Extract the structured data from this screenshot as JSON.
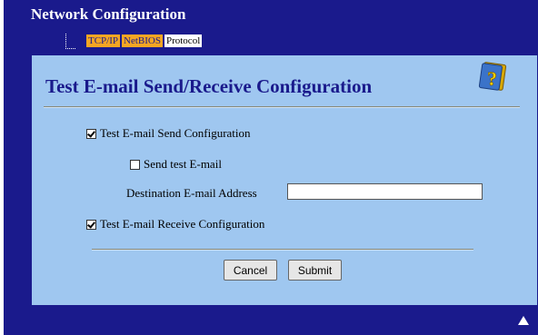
{
  "app": {
    "title": "Network Configuration"
  },
  "nav": {
    "tabs": [
      {
        "label": "TCP/IP"
      },
      {
        "label": "NetBIOS"
      },
      {
        "label": "Protocol"
      }
    ]
  },
  "panel": {
    "title": "Test E-mail Send/Receive Configuration",
    "help_icon": "help-book-icon"
  },
  "form": {
    "send_config": {
      "label": "Test E-mail Send Configuration",
      "checked": true
    },
    "send_test": {
      "label": "Send test E-mail",
      "checked": false
    },
    "destination": {
      "label": "Destination E-mail Address",
      "value": "",
      "placeholder": ""
    },
    "receive_config": {
      "label": "Test E-mail Receive Configuration",
      "checked": true
    }
  },
  "buttons": {
    "cancel": "Cancel",
    "submit": "Submit"
  },
  "colors": {
    "background": "#1a1a8c",
    "panel": "#9fc7f0",
    "tab_highlight": "#f5a623"
  }
}
